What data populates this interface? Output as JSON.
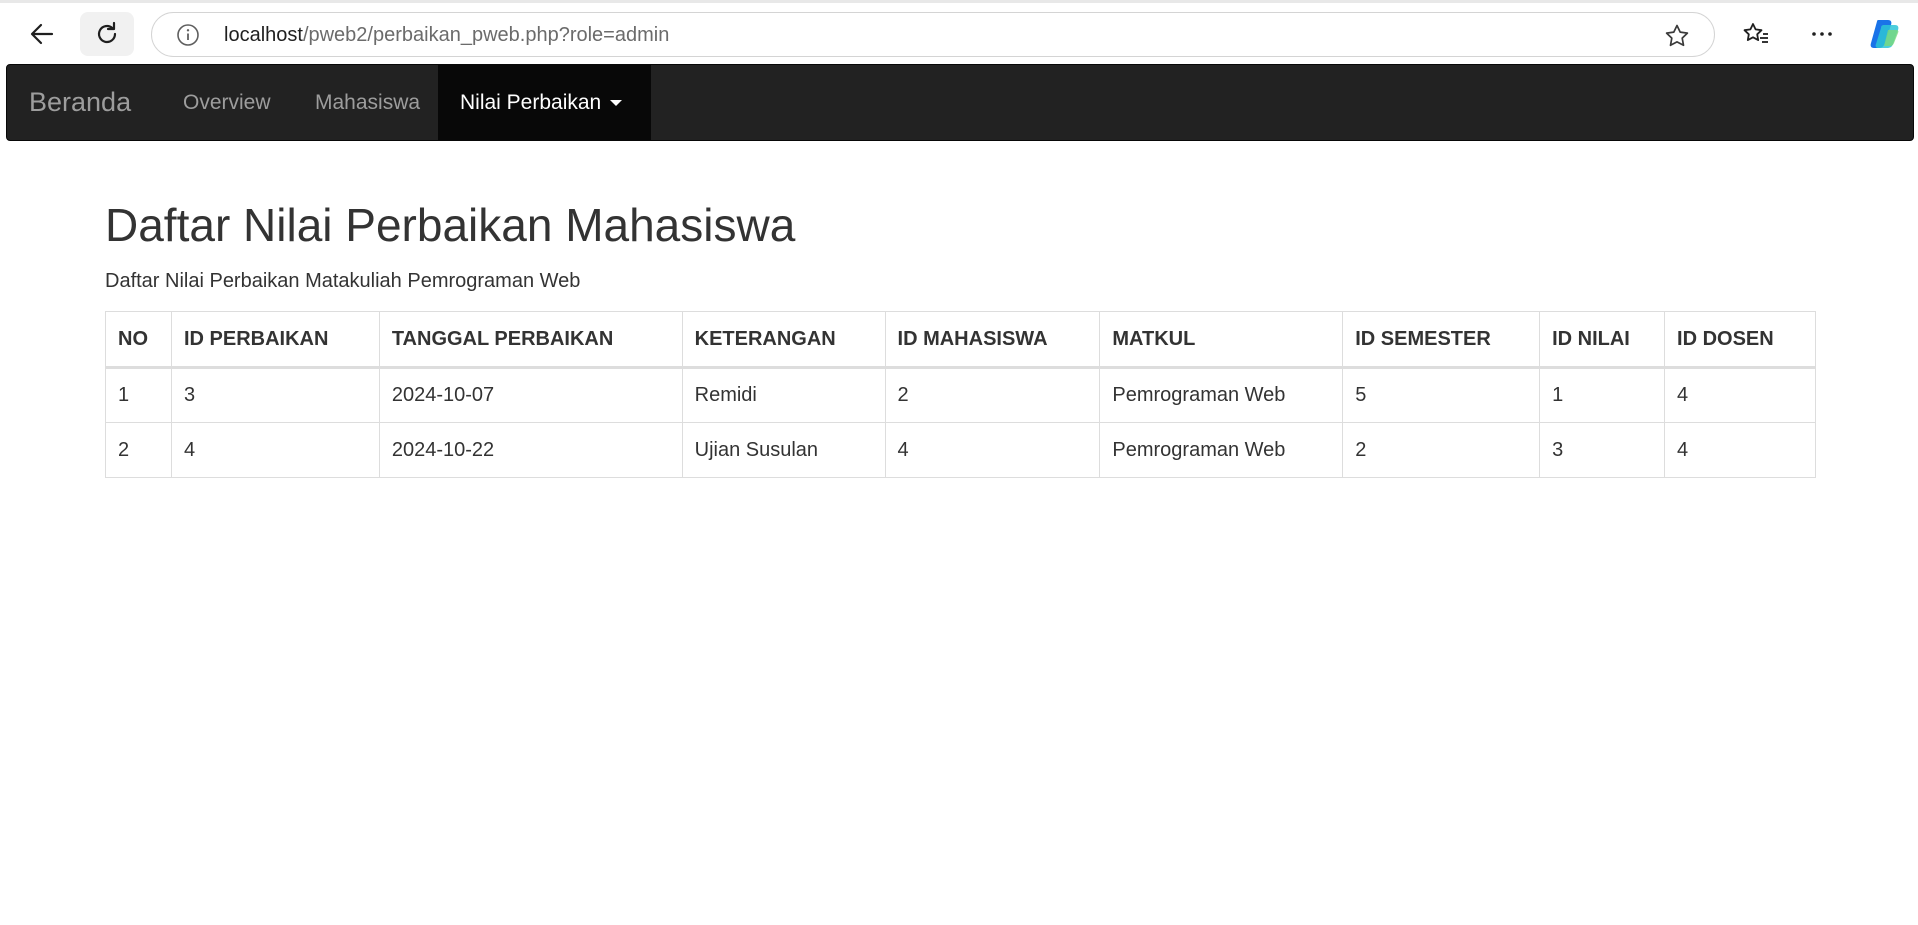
{
  "browser": {
    "url_host": "localhost",
    "url_path": "/pweb2/perbaikan_pweb.php?role=admin",
    "icons": [
      "back-arrow-icon",
      "reload-icon",
      "info-icon",
      "star-icon",
      "favorites-icon",
      "more-icon",
      "copilot-icon"
    ]
  },
  "navbar": {
    "brand": "Beranda",
    "items": [
      {
        "label": "Overview"
      },
      {
        "label": "Mahasiswa"
      },
      {
        "label": "Nilai Perbaikan",
        "active": true,
        "dropdown": true
      }
    ],
    "colors": {
      "background": "#222222",
      "active_background": "#080808",
      "link": "#9d9d9d",
      "active_link": "#ffffff"
    }
  },
  "main": {
    "title": "Daftar Nilai Perbaikan Mahasiswa",
    "subtitle": "Daftar Nilai Perbaikan Matakuliah Pemrograman Web"
  },
  "table": {
    "headers": [
      "NO",
      "ID PERBAIKAN",
      "TANGGAL PERBAIKAN",
      "KETERANGAN",
      "ID MAHASISWA",
      "MATKUL",
      "ID SEMESTER",
      "ID NILAI",
      "ID DOSEN"
    ],
    "rows": [
      [
        "1",
        "3",
        "2024-10-07",
        "Remidi",
        "2",
        "Pemrograman Web",
        "5",
        "1",
        "4"
      ],
      [
        "2",
        "4",
        "2024-10-22",
        "Ujian Susulan",
        "4",
        "Pemrograman Web",
        "2",
        "3",
        "4"
      ]
    ]
  }
}
